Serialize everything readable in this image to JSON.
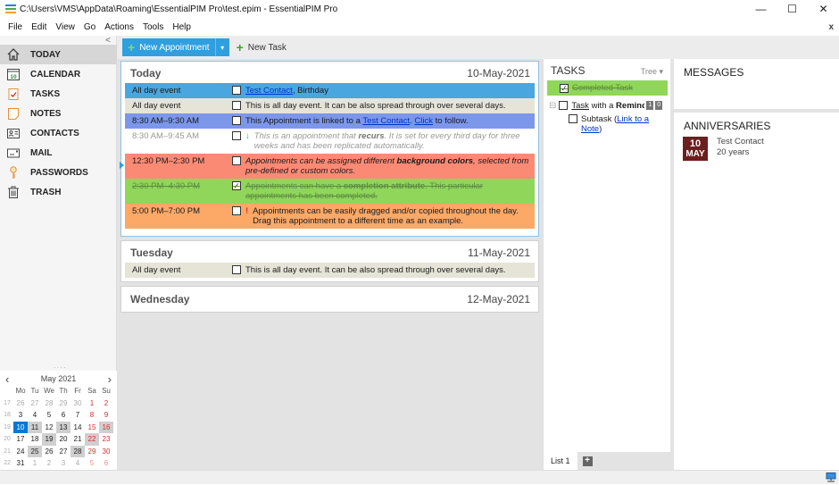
{
  "window": {
    "title": "C:\\Users\\VMS\\AppData\\Roaming\\EssentialPIM Pro\\test.epim - EssentialPIM Pro",
    "minimize": "—",
    "maximize": "☐",
    "close": "✕"
  },
  "menu": {
    "items": [
      "File",
      "Edit",
      "View",
      "Go",
      "Actions",
      "Tools",
      "Help"
    ],
    "close_doc": "x"
  },
  "sidebar": {
    "collapse": "<",
    "items": [
      {
        "label": "TODAY",
        "icon": "home-icon",
        "active": true
      },
      {
        "label": "CALENDAR",
        "icon": "calendar-icon",
        "icon_text": "10"
      },
      {
        "label": "TASKS",
        "icon": "tasks-clipboard-icon"
      },
      {
        "label": "NOTES",
        "icon": "note-icon"
      },
      {
        "label": "CONTACTS",
        "icon": "contact-card-icon"
      },
      {
        "label": "MAIL",
        "icon": "mail-icon"
      },
      {
        "label": "PASSWORDS",
        "icon": "key-icon"
      },
      {
        "label": "TRASH",
        "icon": "trash-icon"
      }
    ],
    "splitter": "····"
  },
  "minical": {
    "prev": "‹",
    "next": "›",
    "month_label": "May  2021",
    "dow": [
      "Mo",
      "Tu",
      "We",
      "Th",
      "Fr",
      "Sa",
      "Su"
    ],
    "weeks": [
      {
        "wk": "17",
        "days": [
          [
            "26",
            "other"
          ],
          [
            "27",
            "other"
          ],
          [
            "28",
            "other"
          ],
          [
            "29",
            "other"
          ],
          [
            "30",
            "other"
          ],
          [
            "1",
            "wkend"
          ],
          [
            "2",
            "wkend"
          ]
        ]
      },
      {
        "wk": "18",
        "days": [
          [
            "3",
            ""
          ],
          [
            "4",
            ""
          ],
          [
            "5",
            ""
          ],
          [
            "6",
            ""
          ],
          [
            "7",
            ""
          ],
          [
            "8",
            "wkend"
          ],
          [
            "9",
            "wkend"
          ]
        ]
      },
      {
        "wk": "19",
        "days": [
          [
            "10",
            "sel"
          ],
          [
            "11",
            "hl"
          ],
          [
            "12",
            ""
          ],
          [
            "13",
            "hl"
          ],
          [
            "14",
            ""
          ],
          [
            "15",
            "wkend"
          ],
          [
            "16",
            "wkend hl"
          ]
        ]
      },
      {
        "wk": "20",
        "days": [
          [
            "17",
            ""
          ],
          [
            "18",
            ""
          ],
          [
            "19",
            "hl"
          ],
          [
            "20",
            ""
          ],
          [
            "21",
            ""
          ],
          [
            "22",
            "wkend hl"
          ],
          [
            "23",
            "wkend"
          ]
        ]
      },
      {
        "wk": "21",
        "days": [
          [
            "24",
            ""
          ],
          [
            "25",
            "hl"
          ],
          [
            "26",
            ""
          ],
          [
            "27",
            ""
          ],
          [
            "28",
            "hl"
          ],
          [
            "29",
            "wkend"
          ],
          [
            "30",
            "wkend"
          ]
        ]
      },
      {
        "wk": "22",
        "days": [
          [
            "31",
            ""
          ],
          [
            "1",
            "other"
          ],
          [
            "2",
            "other"
          ],
          [
            "3",
            "other"
          ],
          [
            "4",
            "other"
          ],
          [
            "5",
            "other wkend"
          ],
          [
            "6",
            "other wkend"
          ]
        ]
      }
    ]
  },
  "toolbar": {
    "new_appointment": "New Appointment",
    "dropdown": "▾",
    "new_task": "New Task"
  },
  "days": [
    {
      "name": "Today",
      "date": "10-May-2021",
      "events": [
        {
          "time": "All day event",
          "color": "#4aa6df",
          "link1": "Test Contact",
          "text": ", Birthday"
        },
        {
          "time": "All day event",
          "color": "#e6e4d7",
          "text": "This is all day event. It can be also spread through over several days."
        },
        {
          "time": "8:30 AM–9:30 AM",
          "color": "#7c97ea",
          "text_a": "This Appointment is linked to a ",
          "link1": "Test Contact",
          "text_b": ". ",
          "link2": "Click",
          "text_c": " to follow."
        },
        {
          "time": "8:30 AM–9:45 AM",
          "color": "#ffffff",
          "mark": "↓",
          "text_a": "This is an appointment that ",
          "bold": "recurs",
          "text_b": ". It is set for every third day for three weeks and has been replicated automatically."
        },
        {
          "time": "12:30 PM–2:30 PM",
          "color": "#fb8a75",
          "text_a": "Appointments can be assigned different ",
          "bold": "background colors",
          "text_b": ", selected from pre-defined or custom colors."
        },
        {
          "time": "2:30 PM–4:30 PM",
          "color": "#8fd65a",
          "checked": true,
          "text_a": "Appointments can have a ",
          "bold": "completion attribute",
          "text_b": ". This particular appointments has been completed."
        },
        {
          "time": "5:00 PM–7:00 PM",
          "color": "#fca867",
          "mark": "!",
          "text": "Appointments can be easily dragged and/or copied throughout the day. Drag this appointment to a different time as an example."
        }
      ]
    },
    {
      "name": "Tuesday",
      "date": "11-May-2021",
      "events": [
        {
          "time": "All day event",
          "color": "#e6e4d7",
          "text": "This is all day event. It can be also spread through over several days."
        }
      ]
    },
    {
      "name": "Wednesday",
      "date": "12-May-2021",
      "events": []
    }
  ],
  "tasks": {
    "title": "TASKS",
    "view": "Tree ▾",
    "items": [
      {
        "label": "Completed Task",
        "done": true
      },
      {
        "label_link": "Task",
        "label_mid": " with a ",
        "label_bold": "Remind",
        "badges": [
          "1",
          "0"
        ],
        "expander": "⊟"
      },
      {
        "label": "Subtask (",
        "link": "Link to a Note",
        "label_end": ")"
      }
    ],
    "list_tab": "List 1",
    "add_list": "+"
  },
  "messages": {
    "title": "MESSAGES"
  },
  "anniversaries": {
    "title": "ANNIVERSARIES",
    "items": [
      {
        "day": "10",
        "month": "MAY",
        "name": "Test Contact",
        "detail": "20 years"
      }
    ]
  },
  "colors": {
    "accent": "#2f9fe0",
    "selected_day": "#0078d7",
    "anniv_badge": "#6b1f1f"
  }
}
